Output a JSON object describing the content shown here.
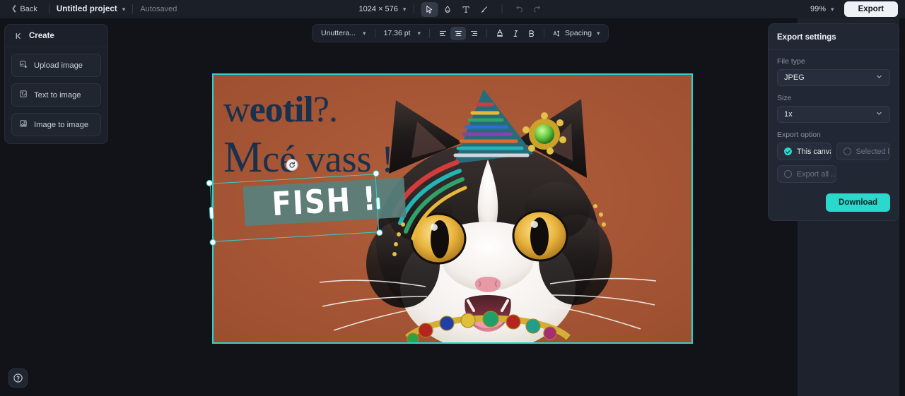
{
  "topbar": {
    "back_label": "Back",
    "project_name": "Untitled project",
    "autosaved_label": "Autosaved",
    "canvas_size": "1024 × 576",
    "zoom_level": "99%",
    "export_label": "Export",
    "tools": [
      {
        "name": "select-tool",
        "icon": "cursor-icon",
        "active": true
      },
      {
        "name": "eraser-tool",
        "icon": "eraser-icon",
        "active": false
      },
      {
        "name": "text-tool",
        "icon": "text-icon",
        "active": false
      },
      {
        "name": "brush-tool",
        "icon": "brush-icon",
        "active": false
      },
      {
        "name": "undo",
        "icon": "undo-icon",
        "active": false
      },
      {
        "name": "redo",
        "icon": "redo-icon",
        "active": false
      }
    ]
  },
  "left_panel": {
    "title": "Create",
    "items": [
      {
        "label": "Upload image",
        "icon": "upload-image-icon"
      },
      {
        "label": "Text to image",
        "icon": "text-to-image-icon"
      },
      {
        "label": "Image to image",
        "icon": "image-to-image-icon"
      }
    ]
  },
  "text_toolbar": {
    "font_family": "Unuttera...",
    "font_size": "17.36 pt",
    "align_left": "align-left",
    "align_center": "align-center",
    "align_right": "align-right",
    "active_align": "align-center",
    "text_color_label": "A",
    "italic_label": "I",
    "bold_label": "B",
    "spacing_label": "Spacing"
  },
  "export_panel": {
    "title": "Export settings",
    "file_type_label": "File type",
    "file_type_value": "JPEG",
    "size_label": "Size",
    "size_value": "1x",
    "export_option_label": "Export option",
    "options": [
      {
        "label": "This canvas",
        "selected": true,
        "disabled": false
      },
      {
        "label": "Selected l...",
        "selected": false,
        "disabled": true
      },
      {
        "label": "Export all ...",
        "selected": false,
        "disabled": true
      }
    ],
    "download_label": "Download"
  },
  "canvas": {
    "poster_line1_a": "w",
    "poster_line1_b": "eotil",
    "poster_line1_c": "?.",
    "poster_line2_cap": "M",
    "poster_line2_rest": "cé vass !",
    "selected_text_object": "FISH !",
    "background_color": "#a85737",
    "text_color": "#18314f",
    "selection_color": "#2fd2cc",
    "fish_block_color": "#58807c"
  },
  "help": {
    "label": "?"
  }
}
